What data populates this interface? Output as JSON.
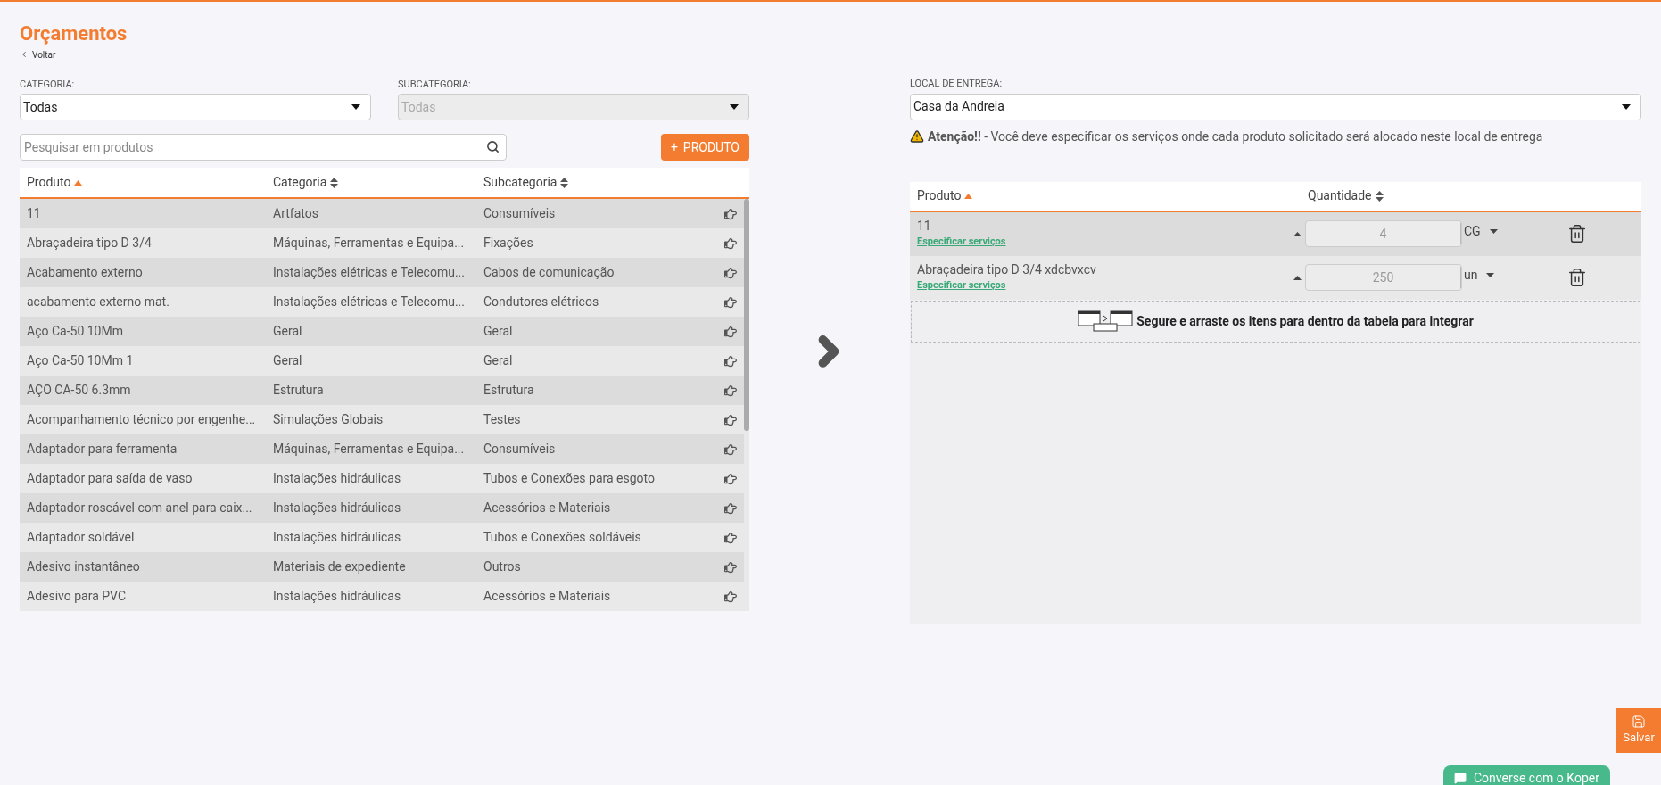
{
  "page": {
    "title": "Orçamentos",
    "back_link": "Voltar"
  },
  "filters": {
    "category": {
      "label": "CATEGORIA:",
      "value": "Todas",
      "disabled": false
    },
    "subcategory": {
      "label": "SUBCATEGORIA:",
      "value": "Todas",
      "disabled": true
    }
  },
  "search": {
    "placeholder": "Pesquisar em produtos"
  },
  "add_button": {
    "icon": "+",
    "label": "PRODUTO"
  },
  "products_table": {
    "columns": [
      {
        "label": "Produto",
        "sorted": true
      },
      {
        "label": "Categoria",
        "sorted": false
      },
      {
        "label": "Subcategoria",
        "sorted": false
      }
    ],
    "rows": [
      {
        "product": "11",
        "category": "Artfatos",
        "subcategory": "Consumíveis"
      },
      {
        "product": "Abraçadeira tipo D 3/4",
        "category": "Máquinas, Ferramentas e Equipa...",
        "subcategory": "Fixações"
      },
      {
        "product": "Acabamento externo",
        "category": "Instalações elétricas e Telecomu...",
        "subcategory": "Cabos de comunicação"
      },
      {
        "product": "acabamento externo mat.",
        "category": "Instalações elétricas e Telecomu...",
        "subcategory": "Condutores elétricos"
      },
      {
        "product": "Aço Ca-50 10Mm",
        "category": "Geral",
        "subcategory": "Geral"
      },
      {
        "product": "Aço Ca-50 10Mm 1",
        "category": "Geral",
        "subcategory": "Geral"
      },
      {
        "product": "AÇO CA-50 6.3mm",
        "category": "Estrutura",
        "subcategory": "Estrutura"
      },
      {
        "product": "Acompanhamento técnico por engenhe...",
        "category": "Simulações Globais",
        "subcategory": "Testes"
      },
      {
        "product": "Adaptador para ferramenta",
        "category": "Máquinas, Ferramentas e Equipa...",
        "subcategory": "Consumíveis"
      },
      {
        "product": "Adaptador para saída de vaso",
        "category": "Instalações hidráulicas",
        "subcategory": "Tubos e Conexões para esgoto"
      },
      {
        "product": "Adaptador roscável com anel para caix...",
        "category": "Instalações hidráulicas",
        "subcategory": "Acessórios e Materiais"
      },
      {
        "product": "Adaptador soldável",
        "category": "Instalações hidráulicas",
        "subcategory": "Tubos e Conexões soldáveis"
      },
      {
        "product": "Adesivo instantâneo",
        "category": "Materiais de expediente",
        "subcategory": "Outros"
      },
      {
        "product": "Adesivo para PVC",
        "category": "Instalações hidráulicas",
        "subcategory": "Acessórios e Materiais"
      }
    ]
  },
  "delivery": {
    "label": "LOCAL DE ENTREGA:",
    "value": "Casa da Andreia",
    "warning": "**Atenção!!** - Você deve especificar os serviços onde cada produto solicitado será alocado neste local de entrega"
  },
  "selected_table": {
    "columns": [
      {
        "label": "Produto",
        "sorted": true
      },
      {
        "label": "Quantidade",
        "sorted": false
      }
    ],
    "rows": [
      {
        "product": "11",
        "link": "Especificar serviços",
        "quantity": "4",
        "unit": "CG"
      },
      {
        "product": "Abraçadeira tipo D 3/4 xdcbvxcv",
        "link": "Especificar serviços",
        "quantity": "250",
        "unit": "un"
      }
    ],
    "drop_hint": "Segure e arraste os itens para dentro da tabela para integrar"
  },
  "save_button": "Salvar",
  "chat_button": "Converse com o Koper"
}
